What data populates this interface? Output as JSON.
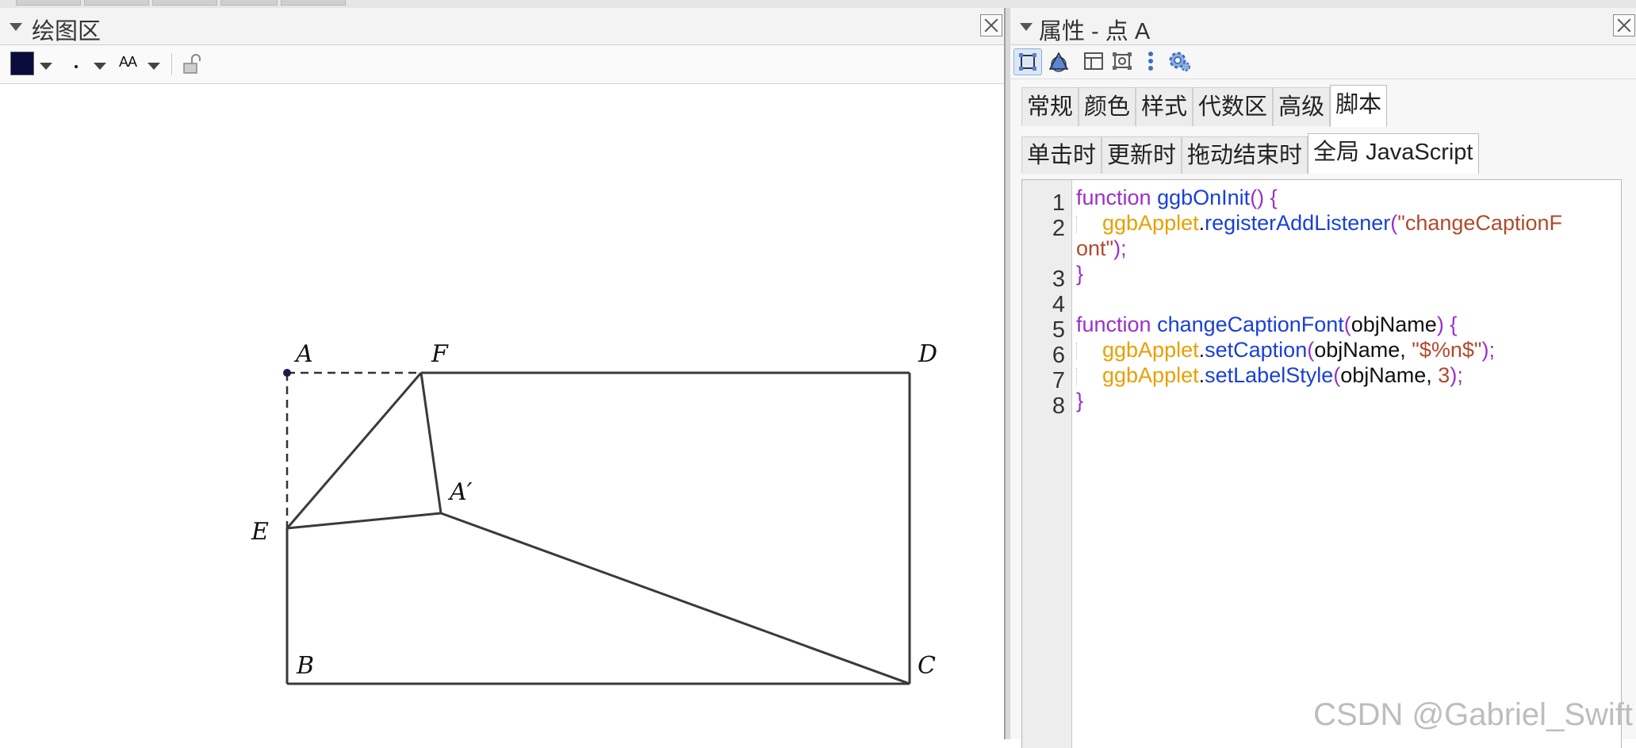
{
  "graphics_panel": {
    "title": "绘图区",
    "stylebar": {
      "color": "#0b0b3d",
      "text_size_label": "AA"
    }
  },
  "figure": {
    "points": [
      {
        "name": "A",
        "label": "A"
      },
      {
        "name": "F",
        "label": "F"
      },
      {
        "name": "D",
        "label": "D"
      },
      {
        "name": "A-prime",
        "label": "A′"
      },
      {
        "name": "E",
        "label": "E"
      },
      {
        "name": "B",
        "label": "B"
      },
      {
        "name": "C",
        "label": "C"
      }
    ]
  },
  "properties_panel": {
    "title": "属性 - 点 A",
    "tabs": [
      "常规",
      "颜色",
      "样式",
      "代数区",
      "高级",
      "脚本"
    ],
    "active_tab": "脚本",
    "script_tabs": [
      "单击时",
      "更新时",
      "拖动结束时",
      "全局 JavaScript"
    ],
    "active_script_tab": "全局 JavaScript",
    "line_numbers": [
      "1",
      "2",
      "3",
      "4",
      "5",
      "6",
      "7",
      "8"
    ],
    "code": {
      "l1_kw": "function",
      "l1_fn": "ggbOnInit",
      "l1_rest": "() {",
      "l2_obj": "ggbApplet",
      "l2_dot": ".",
      "l2_fn": "registerAddListener",
      "l2_open": "(",
      "l2_str_a": "\"changeCaptionF",
      "l2b_str": "ont\"",
      "l2b_end": ");",
      "l3": "}",
      "l5_kw": "function",
      "l5_fn": "changeCaptionFont",
      "l5_open": "(",
      "l5_arg": "objName",
      "l5_close": ") {",
      "l6_obj": "ggbApplet",
      "l6_dot": ".",
      "l6_fn": "setCaption",
      "l6_open": "(",
      "l6_arg": "objName, ",
      "l6_str": "\"$%n$\"",
      "l6_end": ");",
      "l7_obj": "ggbApplet",
      "l7_dot": ".",
      "l7_fn": "setLabelStyle",
      "l7_open": "(",
      "l7_arg": "objName, ",
      "l7_num": "3",
      "l7_end": ");",
      "l8": "}"
    }
  },
  "watermark": "CSDN @Gabriel_Swift"
}
